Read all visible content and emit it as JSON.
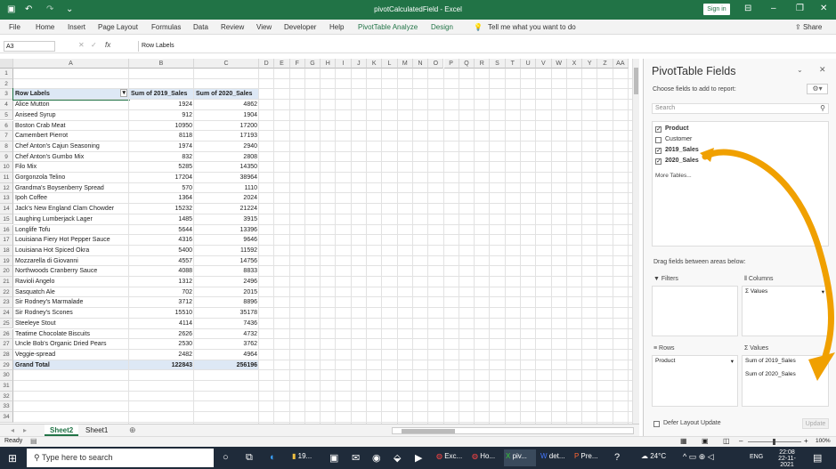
{
  "window": {
    "title": "pivotCalculatedField  -  Excel",
    "sign_in": "Sign in"
  },
  "menu": [
    "File",
    "Home",
    "Insert",
    "Page Layout",
    "Formulas",
    "Data",
    "Review",
    "View",
    "Developer",
    "Help",
    "PivotTable Analyze",
    "Design"
  ],
  "tell_me": "Tell me what you want to do",
  "share": "Share",
  "name_box": "A3",
  "formula_value": "Row Labels",
  "columns": [
    "A",
    "B",
    "C",
    "D",
    "E",
    "F",
    "G",
    "H",
    "I",
    "J",
    "K",
    "L",
    "M",
    "N",
    "O",
    "P",
    "Q",
    "R",
    "S",
    "T",
    "U",
    "V",
    "W",
    "X",
    "Y",
    "Z",
    "AA"
  ],
  "rows": [
    "1",
    "2",
    "3",
    "4",
    "5",
    "6",
    "7",
    "8",
    "9",
    "10",
    "11",
    "12",
    "13",
    "14",
    "15",
    "16",
    "17",
    "18",
    "19",
    "20",
    "21",
    "22",
    "23",
    "24",
    "25",
    "26",
    "27",
    "28",
    "29",
    "30",
    "31",
    "32",
    "33",
    "34"
  ],
  "pivot": {
    "headers": [
      "Row Labels",
      "Sum of 2019_Sales",
      "Sum of 2020_Sales"
    ],
    "data": [
      [
        "Alice Mutton",
        "1924",
        "4862"
      ],
      [
        "Aniseed Syrup",
        "912",
        "1904"
      ],
      [
        "Boston Crab Meat",
        "10950",
        "17200"
      ],
      [
        "Camembert Pierrot",
        "8118",
        "17193"
      ],
      [
        "Chef Anton's Cajun Seasoning",
        "1974",
        "2940"
      ],
      [
        "Chef Anton's Gumbo Mix",
        "832",
        "2808"
      ],
      [
        "Filo Mix",
        "5285",
        "14350"
      ],
      [
        "Gorgonzola Telino",
        "17204",
        "38964"
      ],
      [
        "Grandma's Boysenberry Spread",
        "570",
        "1110"
      ],
      [
        "Ipoh Coffee",
        "1364",
        "2024"
      ],
      [
        "Jack's New England Clam Chowder",
        "15232",
        "21224"
      ],
      [
        "Laughing Lumberjack Lager",
        "1485",
        "3915"
      ],
      [
        "Longlife Tofu",
        "5644",
        "13396"
      ],
      [
        "Louisiana Fiery Hot Pepper Sauce",
        "4316",
        "9646"
      ],
      [
        "Louisiana Hot Spiced Okra",
        "5400",
        "11592"
      ],
      [
        "Mozzarella di Giovanni",
        "4557",
        "14756"
      ],
      [
        "Northwoods Cranberry Sauce",
        "4088",
        "8833"
      ],
      [
        "Ravioli Angelo",
        "1312",
        "2496"
      ],
      [
        "Sasquatch Ale",
        "702",
        "2015"
      ],
      [
        "Sir Rodney's Marmalade",
        "3712",
        "8896"
      ],
      [
        "Sir Rodney's Scones",
        "15510",
        "35178"
      ],
      [
        "Steeleye Stout",
        "4114",
        "7436"
      ],
      [
        "Teatime Chocolate Biscuits",
        "2626",
        "4732"
      ],
      [
        "Uncle Bob's Organic Dried Pears",
        "2530",
        "3762"
      ],
      [
        "Veggie-spread",
        "2482",
        "4964"
      ]
    ],
    "total": [
      "Grand Total",
      "122843",
      "256196"
    ]
  },
  "sheets": [
    "Sheet2",
    "Sheet1"
  ],
  "status": {
    "mode": "Ready",
    "zoom": "100%"
  },
  "pane": {
    "title": "PivotTable Fields",
    "subtitle": "Choose fields to add to report:",
    "search_placeholder": "Search",
    "fields": [
      {
        "name": "Product",
        "checked": true
      },
      {
        "name": "Customer",
        "checked": false
      },
      {
        "name": "2019_Sales",
        "checked": true
      },
      {
        "name": "2020_Sales",
        "checked": true
      }
    ],
    "more_tables": "More Tables...",
    "drag_label": "Drag fields between areas below:",
    "filters": "Filters",
    "columns": "Columns",
    "rows": "Rows",
    "values": "Values",
    "columns_item": "Σ Values",
    "rows_item": "Product",
    "values_items": [
      "Sum of 2019_Sales",
      "Sum of 2020_Sales"
    ],
    "defer": "Defer Layout Update",
    "update": "Update",
    "arrow_color": "#f0a000"
  },
  "taskbar": {
    "search": "Type here to search",
    "apps": [
      "19...",
      "Exc...",
      "Ho...",
      "piv...",
      "det...",
      "Pre..."
    ],
    "weather": "24°C",
    "lang": "ENG",
    "time": "22:08",
    "date": "22-11-2021"
  }
}
